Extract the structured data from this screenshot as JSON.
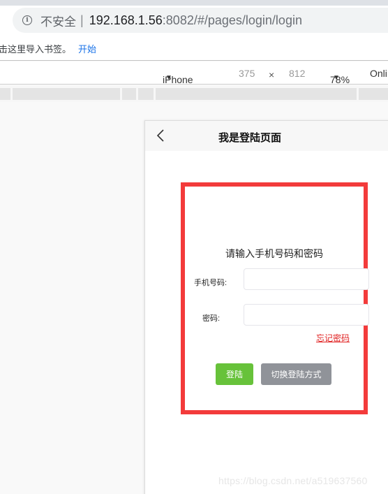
{
  "browser": {
    "security_label": "不安全",
    "url_host": "192.168.1.56",
    "url_rest": ":8082/#/pages/login/login",
    "bookmarks_text": "击这里导入书签。",
    "bookmarks_link": "开始"
  },
  "device_toolbar": {
    "device": "iPhone X",
    "width": "375",
    "times": "×",
    "height": "812",
    "zoom": "78%",
    "throttle": "Onli"
  },
  "page": {
    "nav_title": "我是登陆页面",
    "prompt": "请输入手机号码和密码",
    "phone_label": "手机号码:",
    "phone_value": "",
    "password_label": "密码:",
    "password_value": "",
    "forgot_password": "忘记密码",
    "login_button": "登陆",
    "switch_button": "切换登陆方式"
  },
  "watermark": "https://blog.csdn.net/a519637560",
  "colors": {
    "highlight": "#f33b3b",
    "login_button": "#67c23a",
    "switch_button": "#909399",
    "forgot_link": "#e02020"
  }
}
